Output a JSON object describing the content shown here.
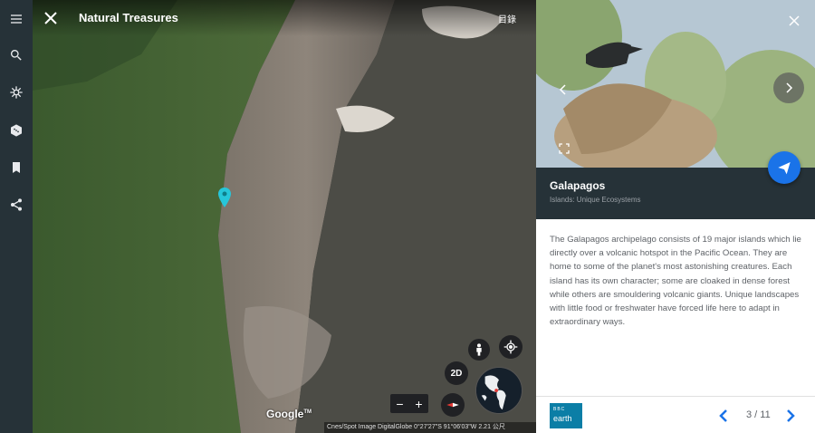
{
  "map": {
    "story_title": "Natural Treasures",
    "toc_label": "目錄",
    "btn_2d_label": "2D",
    "zoom_out_label": "−",
    "zoom_in_label": "+",
    "google_logo": "Google",
    "google_logo_sup": "TM",
    "attribution": "Cnes/Spot Image  DigitalGlobe    0°27'27\"S 91°06'03\"W  2.21 公尺"
  },
  "sidebar": {
    "items": [
      {
        "icon": "menu-icon"
      },
      {
        "icon": "search-icon"
      },
      {
        "icon": "voyager-icon"
      },
      {
        "icon": "dice-icon"
      },
      {
        "icon": "bookmark-icon"
      },
      {
        "icon": "share-icon"
      }
    ]
  },
  "card": {
    "place_name": "Galapagos",
    "place_subtitle": "Islands: Unique Ecosystems",
    "description": "The Galapagos archipelago consists of 19 major islands which lie directly over a volcanic hotspot in the Pacific Ocean. They are home to some of the planet's most astonishing creatures. Each island has its own character; some are cloaked in dense forest while others are smouldering volcanic giants. Unique landscapes with little food or freshwater have forced life here to adapt in extraordinary ways.",
    "counter": "3 / 11",
    "logo_line1": "BBC",
    "logo_line2": "earth"
  },
  "colors": {
    "rail": "#263238",
    "card_header": "#263238",
    "accent": "#1a73e8",
    "placemark": "#26c6da"
  }
}
